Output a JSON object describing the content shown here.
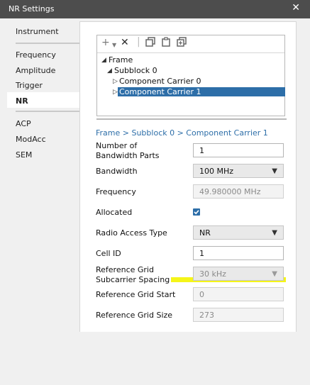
{
  "window": {
    "title": "NR Settings",
    "close_glyph": "✕"
  },
  "nav": {
    "items": [
      {
        "label": "Instrument"
      },
      {
        "label": "Frequency"
      },
      {
        "label": "Amplitude"
      },
      {
        "label": "Trigger"
      },
      {
        "label": "NR"
      },
      {
        "label": "ACP"
      },
      {
        "label": "ModAcc"
      },
      {
        "label": "SEM"
      }
    ],
    "selected": "NR"
  },
  "toolbar": {
    "add_icon": "plus-icon",
    "dropdown_icon": "chevron-down-icon",
    "delete_icon": "x-icon",
    "copy_icon": "copy-icon",
    "paste_icon": "paste-icon",
    "duplicate_icon": "duplicate-icon"
  },
  "tree": {
    "nodes": [
      {
        "label": "Frame"
      },
      {
        "label": "Subblock 0"
      },
      {
        "label": "Component Carrier 0"
      },
      {
        "label": "Component Carrier 1"
      }
    ]
  },
  "breadcrumb": {
    "text": "Frame > Subblock 0 > Component Carrier 1"
  },
  "form": {
    "num_bw_parts": {
      "label": "Number of Bandwidth Parts",
      "value": "1"
    },
    "bandwidth": {
      "label": "Bandwidth",
      "value": "100 MHz"
    },
    "frequency": {
      "label": "Frequency",
      "value": "49.980000 MHz"
    },
    "allocated": {
      "label": "Allocated",
      "checked": true
    },
    "radio_access_type": {
      "label": "Radio Access Type",
      "value": "NR"
    },
    "cell_id": {
      "label": "Cell ID",
      "value": "1"
    },
    "ref_grid_scs": {
      "label": "Reference Grid Subcarrier Spacing",
      "value": "30 kHz"
    },
    "ref_grid_start": {
      "label": "Reference Grid Start",
      "value": "0"
    },
    "ref_grid_size": {
      "label": "Reference Grid Size",
      "value": "273"
    }
  },
  "colors": {
    "accent": "#2d6ea8",
    "highlight": "#f4f400"
  }
}
